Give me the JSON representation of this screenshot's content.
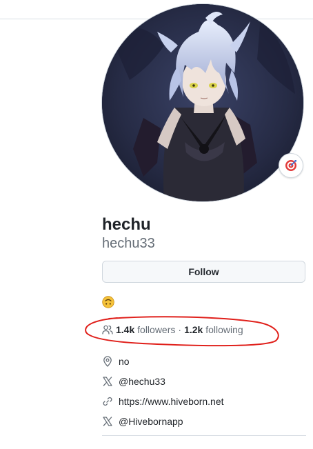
{
  "profile": {
    "display_name": "hechu",
    "username": "hechu33",
    "avatar": "avatar-illustration",
    "status_emoji": "dart-emoji",
    "bio_emoji": "upside-down-face-emoji"
  },
  "actions": {
    "follow_label": "Follow"
  },
  "stats": {
    "followers_count": "1.4k",
    "followers_label": "followers",
    "separator": "·",
    "following_count": "1.2k",
    "following_label": "following"
  },
  "details": {
    "location": "no",
    "twitter_1": "@hechu33",
    "website": "https://www.hiveborn.net",
    "twitter_2": "@Hivebornapp"
  },
  "colors": {
    "text_primary": "#1f2328",
    "text_muted": "#656d76",
    "border": "#d0d7de",
    "button_bg": "#f6f8fa",
    "annotation": "#e0201b"
  }
}
